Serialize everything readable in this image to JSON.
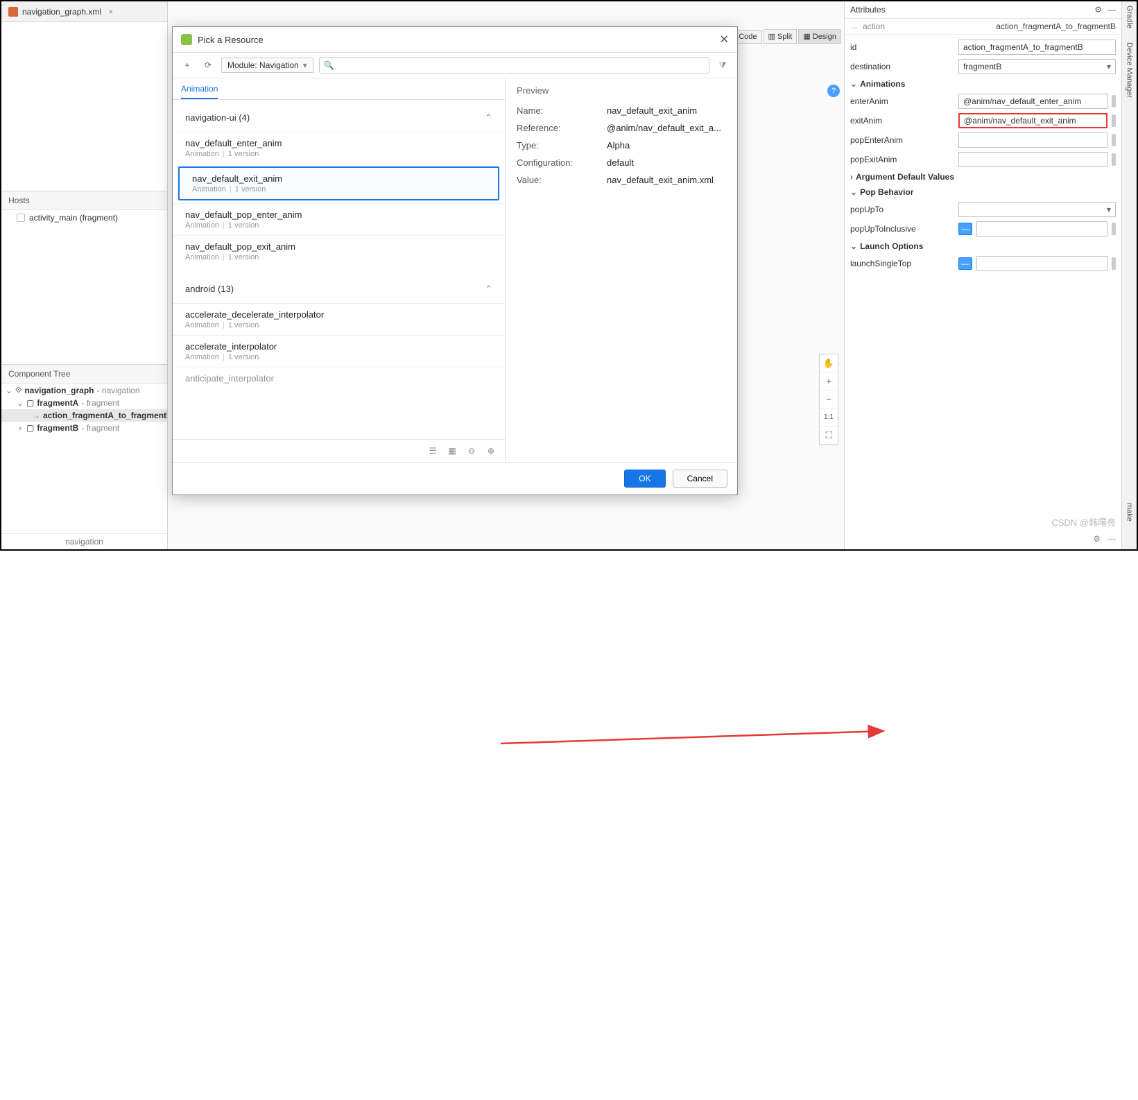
{
  "tab": {
    "filename": "navigation_graph.xml"
  },
  "hosts": {
    "title": "Hosts",
    "item": "activity_main (fragment)"
  },
  "componentTree": {
    "title": "Component Tree",
    "root": {
      "name": "navigation_graph",
      "suffix": " - navigation"
    },
    "fragA": {
      "name": "fragmentA",
      "suffix": " - fragment"
    },
    "action": {
      "name": "action_fragmentA_to_fragmentB"
    },
    "fragB": {
      "name": "fragmentB",
      "suffix": " - fragment"
    }
  },
  "navFooter": "navigation",
  "viewModes": {
    "code": "Code",
    "split": "Split",
    "design": "Design"
  },
  "attributes": {
    "title": "Attributes",
    "breadcrumb_type": "action",
    "breadcrumb_value": "action_fragmentA_to_fragmentB",
    "id_label": "id",
    "id_value": "action_fragmentA_to_fragmentB",
    "dest_label": "destination",
    "dest_value": "fragmentB",
    "sections": {
      "animations": "Animations",
      "argDefaults": "Argument Default Values",
      "popBehavior": "Pop Behavior",
      "launchOptions": "Launch Options"
    },
    "enterAnim_label": "enterAnim",
    "enterAnim_value": "@anim/nav_default_enter_anim",
    "exitAnim_label": "exitAnim",
    "exitAnim_value": "@anim/nav_default_exit_anim",
    "popEnterAnim_label": "popEnterAnim",
    "popExitAnim_label": "popExitAnim",
    "popUpTo_label": "popUpTo",
    "popUpToInclusive_label": "popUpToInclusive",
    "launchSingleTop_label": "launchSingleTop"
  },
  "zoom": {
    "pan": "✋",
    "zoomIn": "+",
    "zoomOut": "−",
    "oneToOne": "1:1",
    "fit": "⛶"
  },
  "rightStrip": {
    "gradle": "Gradle",
    "deviceMgr": "Device Manager",
    "make": "make"
  },
  "dialog": {
    "title": "Pick a Resource",
    "module": "Module: Navigation",
    "searchPlaceholder": "",
    "tab": "Animation",
    "groups": {
      "navUi": "navigation-ui (4)",
      "android": "android (13)"
    },
    "items": {
      "enter": {
        "name": "nav_default_enter_anim",
        "type": "Animation",
        "ver": "1 version"
      },
      "exit": {
        "name": "nav_default_exit_anim",
        "type": "Animation",
        "ver": "1 version"
      },
      "popEnter": {
        "name": "nav_default_pop_enter_anim",
        "type": "Animation",
        "ver": "1 version"
      },
      "popExit": {
        "name": "nav_default_pop_exit_anim",
        "type": "Animation",
        "ver": "1 version"
      },
      "accelDecel": {
        "name": "accelerate_decelerate_interpolator",
        "type": "Animation",
        "ver": "1 version"
      },
      "accel": {
        "name": "accelerate_interpolator",
        "type": "Animation",
        "ver": "1 version"
      },
      "anticipate": {
        "name": "anticipate_interpolator",
        "type": "Animation",
        "ver": "1 version"
      }
    },
    "preview": {
      "title": "Preview",
      "name_k": "Name:",
      "name_v": "nav_default_exit_anim",
      "ref_k": "Reference:",
      "ref_v": "@anim/nav_default_exit_a...",
      "type_k": "Type:",
      "type_v": "Alpha",
      "config_k": "Configuration:",
      "config_v": "default",
      "value_k": "Value:",
      "value_v": "nav_default_exit_anim.xml"
    },
    "buttons": {
      "ok": "OK",
      "cancel": "Cancel"
    }
  },
  "watermark": "CSDN @韩曙亮"
}
